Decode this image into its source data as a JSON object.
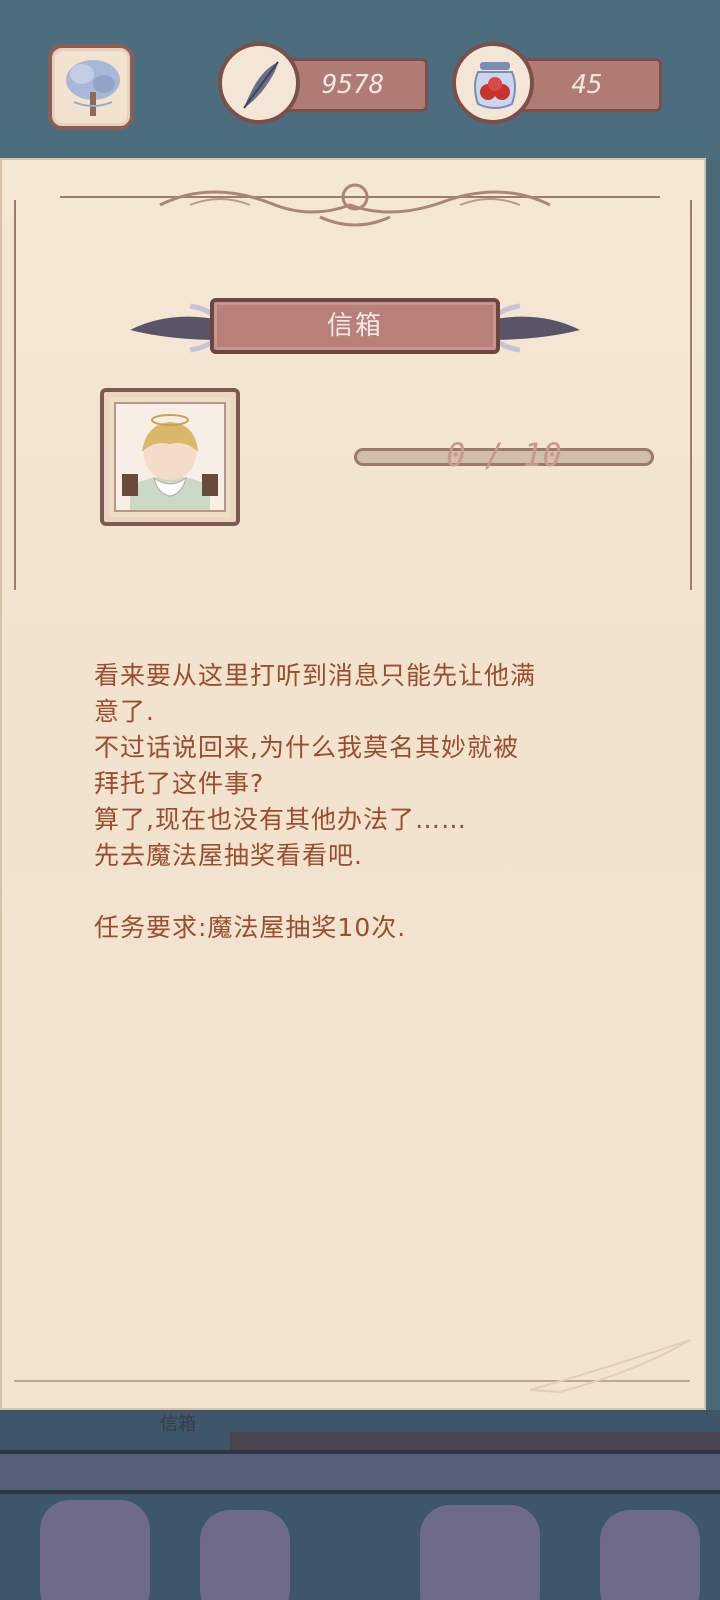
{
  "resources": {
    "feather": {
      "icon": "feather-icon",
      "value": "9578"
    },
    "berries": {
      "icon": "berry-jar-icon",
      "value": "45"
    }
  },
  "banner": {
    "title": "信箱"
  },
  "progress": {
    "current": 0,
    "total": 10,
    "text": "0 / 10"
  },
  "letter": {
    "lines": [
      "看来要从这里打听到消息只能先让他满",
      "意了.",
      "不过话说回来,为什么我莫名其妙就被",
      "拜托了这件事?",
      "算了,现在也没有其他办法了……",
      "先去魔法屋抽奖看看吧."
    ],
    "requirement": "任务要求:魔法屋抽奖10次."
  },
  "scenery": {
    "mailbox_label": "信箱"
  },
  "colors": {
    "accent": "#b07a75",
    "text": "#9a4e2f",
    "paper": "#f4e7d3"
  }
}
